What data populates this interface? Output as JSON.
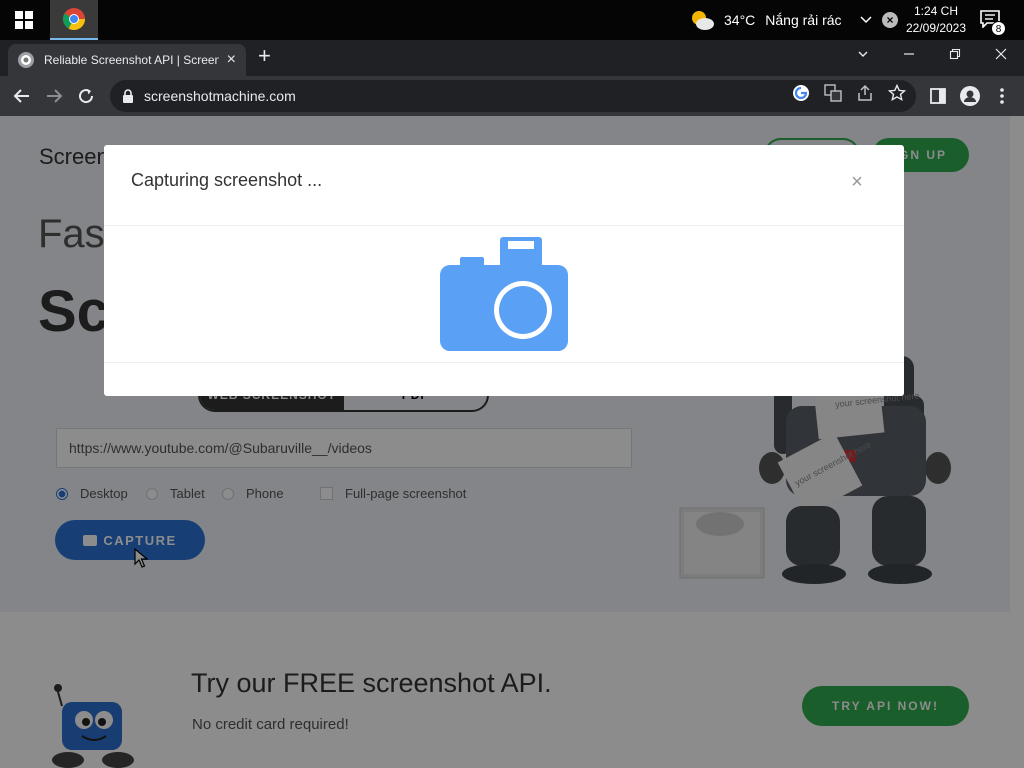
{
  "taskbar": {
    "weather_temp": "34°C",
    "weather_text": "Nắng rải rác",
    "time": "1:24 CH",
    "date": "22/09/2023",
    "notification_count": "8"
  },
  "browser": {
    "tab_title": "Reliable Screenshot API | Screens",
    "url": "screenshotmachine.com"
  },
  "page": {
    "logo_text": "Screens",
    "signup_label": "GN UP",
    "hero_line1": "Fast",
    "hero_line2": "Scr",
    "mode_tabs": [
      "WEB SCREENSHOT",
      "PDF"
    ],
    "url_value": "https://www.youtube.com/@Subaruville__/videos",
    "devices": [
      "Desktop",
      "Tablet",
      "Phone"
    ],
    "fullpage_label": "Full-page screenshot",
    "capture_label": "CAPTURE",
    "robot_cards": [
      "your screenshot here",
      "your screenshot here"
    ],
    "api_title": "Try our FREE screenshot API.",
    "api_subtitle": "No credit card required!",
    "try_api_label": "TRY API NOW!"
  },
  "modal": {
    "title": "Capturing screenshot ...",
    "close_symbol": "×"
  },
  "colors": {
    "accent_blue": "#2b73d8",
    "accent_green": "#2eab4f",
    "camera_blue": "#5aa0f5"
  }
}
